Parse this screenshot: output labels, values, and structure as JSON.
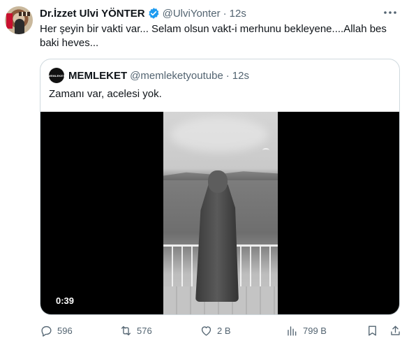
{
  "author": {
    "display_name": "Dr.İzzet Ulvi YÖNTER",
    "handle": "@UlviYonter",
    "separator": "·",
    "time": "12s"
  },
  "tweet_text": "Her şeyin bir vakti var... Selam olsun vakt-i merhunu bekleyene....Allah bes baki heves...",
  "quote": {
    "avatar_text": "MEMLEKET",
    "display_name": "MEMLEKET",
    "handle": "@memleketyoutube",
    "separator": "·",
    "time": "12s",
    "text": "Zamanı var, acelesi yok.",
    "video_duration": "0:39"
  },
  "actions": {
    "replies": "596",
    "reposts": "576",
    "likes": "2 B",
    "views": "799 B"
  },
  "colors": {
    "text_primary": "#0f1419",
    "text_secondary": "#536471",
    "verified_blue": "#1d9bf0",
    "border": "#cfd9de"
  }
}
